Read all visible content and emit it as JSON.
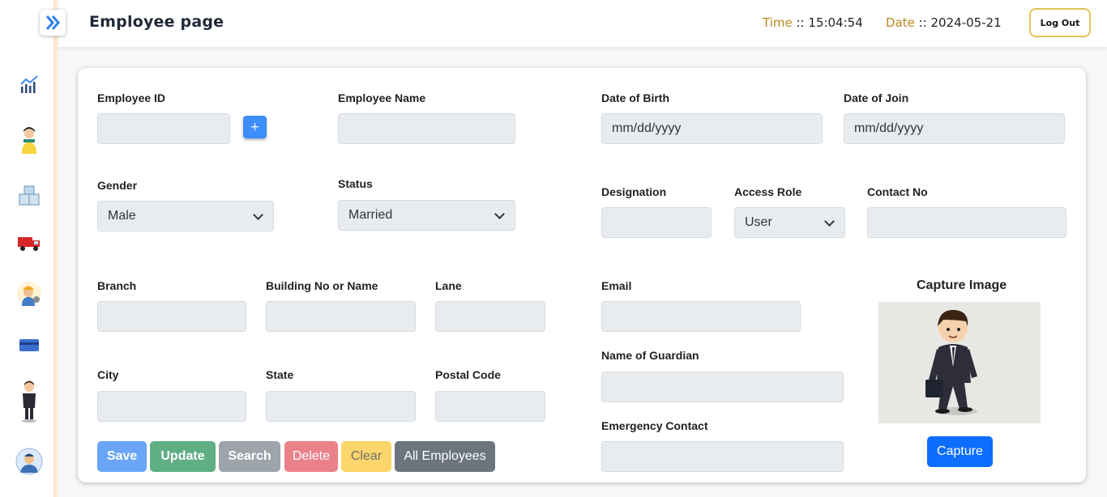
{
  "header": {
    "title": "Employee page",
    "time_label": "Time",
    "time_sep": " :: ",
    "time_value": "15:04:54",
    "date_label": "Date",
    "date_sep": " :: ",
    "date_value": "2024-05-21",
    "logout_label": "Log Out"
  },
  "sidebar": {
    "icons": [
      "chart-icon",
      "customer-icon",
      "packages-icon",
      "delivery-truck-icon",
      "worker-icon",
      "card-icon",
      "employee-icon",
      "profile-icon"
    ]
  },
  "form": {
    "employee_id_label": "Employee ID",
    "add_id_label": "+",
    "employee_name_label": "Employee Name",
    "dob_label": "Date of Birth",
    "dob_value": "mm/dd/yyyy",
    "doj_label": "Date of Join",
    "doj_value": "mm/dd/yyyy",
    "gender_label": "Gender",
    "gender_value": "Male",
    "status_label": "Status",
    "status_value": "Married",
    "designation_label": "Designation",
    "access_role_label": "Access Role",
    "access_role_value": "User",
    "contact_label": "Contact No",
    "branch_label": "Branch",
    "building_label": "Building No or Name",
    "lane_label": "Lane",
    "email_label": "Email",
    "city_label": "City",
    "state_label": "State",
    "postal_label": "Postal Code",
    "guardian_label": "Name of Guardian",
    "emergency_label": "Emergency Contact"
  },
  "capture": {
    "title": "Capture Image",
    "button_label": "Capture"
  },
  "actions": {
    "save": "Save",
    "update": "Update",
    "search": "Search",
    "delete": "Delete",
    "clear": "Clear",
    "all_employees": "All Employees"
  },
  "colors": {
    "save": "#6ba5f7",
    "update": "#5fae84",
    "search": "#9da4ab",
    "delete": "#ea8189",
    "clear": "#fcd66a",
    "all_employees": "#6c757d",
    "accent": "#b8891e"
  }
}
